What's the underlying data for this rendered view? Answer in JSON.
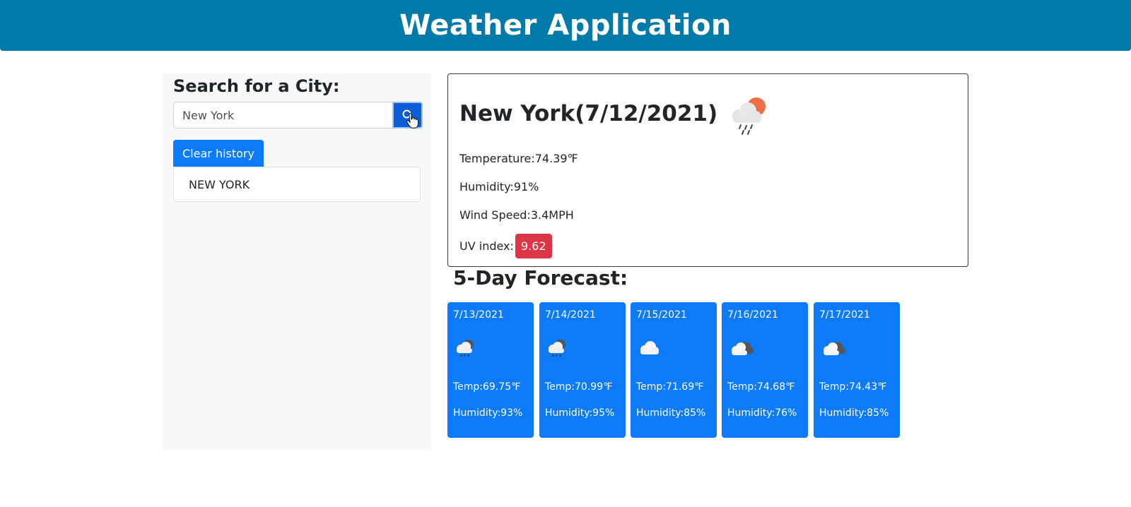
{
  "header": {
    "title": "Weather Application"
  },
  "sidebar": {
    "heading": "Search for a City:",
    "search": {
      "value": "New York",
      "button_icon": "search-icon"
    },
    "clear_label": "Clear history",
    "history": [
      "NEW YORK"
    ]
  },
  "current": {
    "title": "New York(7/12/2021)",
    "icon": "rain-sun-icon",
    "temperature": "Temperature:74.39℉",
    "humidity": "Humidity:91%",
    "wind": "Wind Speed:3.4MPH",
    "uv_label": "UV index:",
    "uv_value": "9.62",
    "uv_color": "#dc3545"
  },
  "forecast": {
    "title": "5-Day Forecast:",
    "days": [
      {
        "date": "7/13/2021",
        "icon": "rain-cloud-icon",
        "temp": "Temp:69.75℉",
        "humidity": "Humidity:93%"
      },
      {
        "date": "7/14/2021",
        "icon": "rain-cloud-icon",
        "temp": "Temp:70.99℉",
        "humidity": "Humidity:95%"
      },
      {
        "date": "7/15/2021",
        "icon": "cloud-icon",
        "temp": "Temp:71.69℉",
        "humidity": "Humidity:85%"
      },
      {
        "date": "7/16/2021",
        "icon": "broken-clouds-icon",
        "temp": "Temp:74.68℉",
        "humidity": "Humidity:76%"
      },
      {
        "date": "7/17/2021",
        "icon": "broken-clouds-icon",
        "temp": "Temp:74.43℉",
        "humidity": "Humidity:85%"
      }
    ]
  },
  "colors": {
    "header_bg": "#007aa8",
    "card_bg": "#0d7bf7",
    "uv_badge": "#dc3545"
  }
}
